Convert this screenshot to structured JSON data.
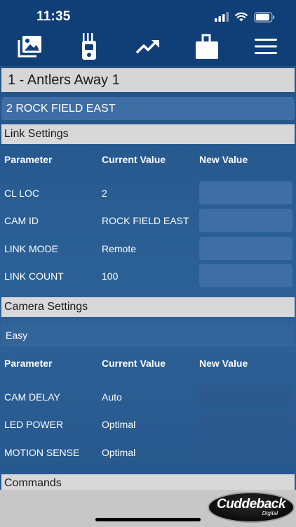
{
  "status_bar": {
    "time": "11:35"
  },
  "toolbar": {
    "items": [
      {
        "icon": "photos-icon"
      },
      {
        "icon": "link-device-icon"
      },
      {
        "icon": "trend-chart-icon"
      },
      {
        "icon": "camera-unit-icon"
      },
      {
        "icon": "hamburger-menu-icon"
      }
    ]
  },
  "site": {
    "name": "1 - Antlers Away 1"
  },
  "camera": {
    "selected": "2 ROCK FIELD EAST"
  },
  "link_settings": {
    "title": "Link Settings",
    "columns": [
      "Parameter",
      "Current Value",
      "New Value"
    ],
    "rows": [
      {
        "parameter": "CL LOC",
        "current": "2",
        "new": ""
      },
      {
        "parameter": "CAM ID",
        "current": "ROCK FIELD EAST",
        "new": ""
      },
      {
        "parameter": "LINK MODE",
        "current": "Remote",
        "new": ""
      },
      {
        "parameter": "LINK COUNT",
        "current": "100",
        "new": ""
      }
    ]
  },
  "camera_settings": {
    "title": "Camera Settings",
    "mode": "Easy",
    "columns": [
      "Parameter",
      "Current Value",
      "New Value"
    ],
    "rows": [
      {
        "parameter": "CAM DELAY",
        "current": "Auto",
        "new": ""
      },
      {
        "parameter": "LED POWER",
        "current": "Optimal",
        "new": ""
      },
      {
        "parameter": "MOTION SENSE",
        "current": "Optimal",
        "new": ""
      }
    ]
  },
  "commands": {
    "title": "Commands"
  },
  "logo": {
    "main": "Cuddeback",
    "sub": "Digital"
  },
  "colors": {
    "header": "#0f3f76",
    "accent": "#3e6ea3",
    "section": "#d8d8d8"
  }
}
